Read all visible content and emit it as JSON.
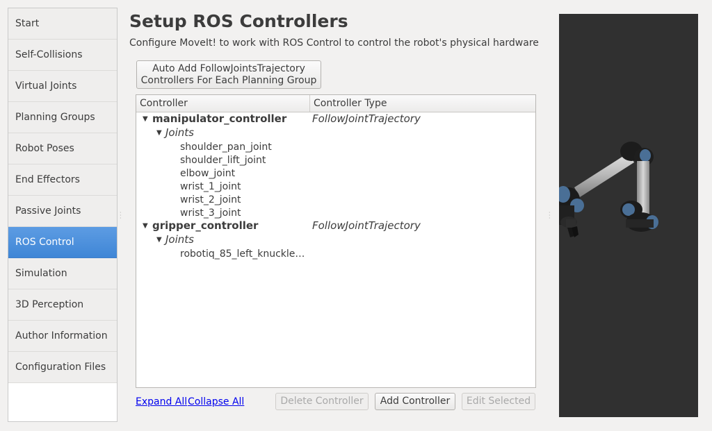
{
  "sidebar": {
    "items": [
      {
        "label": "Start",
        "name": "sidebar-item-start"
      },
      {
        "label": "Self-Collisions",
        "name": "sidebar-item-self-collisions"
      },
      {
        "label": "Virtual Joints",
        "name": "sidebar-item-virtual-joints"
      },
      {
        "label": "Planning Groups",
        "name": "sidebar-item-planning-groups"
      },
      {
        "label": "Robot Poses",
        "name": "sidebar-item-robot-poses"
      },
      {
        "label": "End Effectors",
        "name": "sidebar-item-end-effectors"
      },
      {
        "label": "Passive Joints",
        "name": "sidebar-item-passive-joints"
      },
      {
        "label": "ROS Control",
        "name": "sidebar-item-ros-control",
        "active": true
      },
      {
        "label": "Simulation",
        "name": "sidebar-item-simulation"
      },
      {
        "label": "3D Perception",
        "name": "sidebar-item-3d-perception"
      },
      {
        "label": "Author Information",
        "name": "sidebar-item-author-information"
      },
      {
        "label": "Configuration Files",
        "name": "sidebar-item-configuration-files"
      }
    ]
  },
  "header": {
    "title": "Setup ROS Controllers",
    "subtitle": "Configure MoveIt! to work with ROS Control to control the robot's physical hardware"
  },
  "auto_add_button": {
    "line1": "Auto Add FollowJointsTrajectory",
    "line2": "Controllers For Each Planning Group"
  },
  "tree": {
    "columns": {
      "controller": "Controller",
      "type": "Controller Type"
    },
    "controllers": [
      {
        "name": "manipulator_controller",
        "type": "FollowJointTrajectory",
        "joints_label": "Joints",
        "joints": [
          "shoulder_pan_joint",
          "shoulder_lift_joint",
          "elbow_joint",
          "wrist_1_joint",
          "wrist_2_joint",
          "wrist_3_joint"
        ]
      },
      {
        "name": "gripper_controller",
        "type": "FollowJointTrajectory",
        "joints_label": "Joints",
        "joints": [
          "robotiq_85_left_knuckle…"
        ]
      }
    ]
  },
  "footer": {
    "expand_all": "Expand All",
    "collapse_all": "Collapse All",
    "delete_controller": "Delete Controller",
    "add_controller": "Add Controller",
    "edit_selected": "Edit Selected"
  },
  "icons": {
    "expanded": "triangle-down-icon"
  },
  "colors": {
    "active_item": "#4a8fdc",
    "viewer_background": "#303030",
    "link": "#0000ee"
  }
}
